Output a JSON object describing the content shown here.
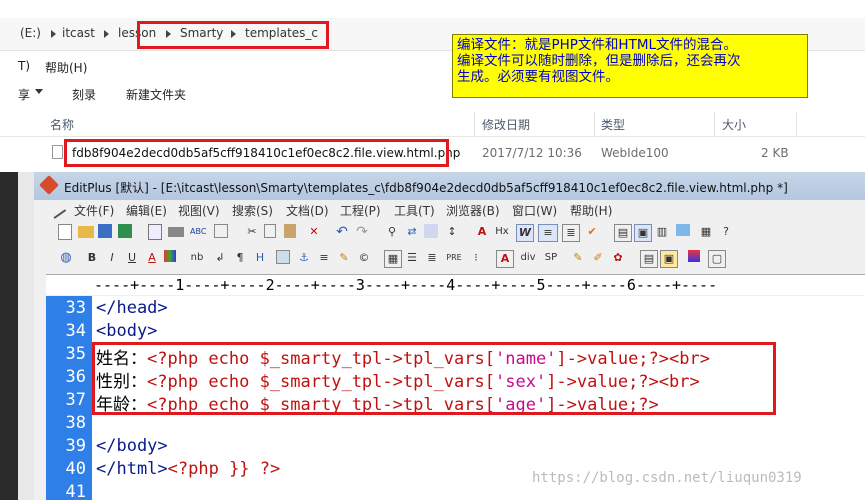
{
  "explorer": {
    "breadcrumb": [
      "(E:)",
      "itcast",
      "lesson",
      "Smarty",
      "templates_c"
    ],
    "menu": {
      "item0": "T)",
      "help": "帮助(H)"
    },
    "toolbar": {
      "share": "享",
      "burn": "刻录",
      "new_folder": "新建文件夹"
    },
    "columns": {
      "name": "名称",
      "modified": "修改日期",
      "type": "类型",
      "size": "大小"
    },
    "file": {
      "name": "fdb8f904e2decd0db5af5cff918410c1ef0ec8c2.file.view.html.php",
      "modified": "2017/7/12 10:36",
      "type": "WebIde100",
      "size": "2 KB"
    }
  },
  "annotation": {
    "lines": [
      "编译文件：就是PHP文件和HTML文件的混合。",
      "编译文件可以随时删除，但是删除后，还会再次",
      "生成。必须要有视图文件。"
    ]
  },
  "editplus": {
    "title": "EditPlus [默认] - [E:\\itcast\\lesson\\Smarty\\templates_c\\fdb8f904e2decd0db5af5cff918410c1ef0ec8c2.file.view.html.php *]",
    "menu": [
      "文件(F)",
      "编辑(E)",
      "视图(V)",
      "搜索(S)",
      "文档(D)",
      "工程(P)",
      "工具(T)",
      "浏览器(B)",
      "窗口(W)",
      "帮助(H)"
    ],
    "ruler": "----+----1----+----2----+----3----+----4----+----5----+----6----+----",
    "line_numbers": [
      "33",
      "34",
      "35",
      "36",
      "37",
      "38",
      "39",
      "40",
      "41"
    ],
    "code": {
      "l33": "</head>",
      "l34": "<body>",
      "l35_label": "姓名：",
      "l35_a": "<?php echo $_smarty_tpl->tpl_vars[",
      "l35_str": "'name'",
      "l35_b": "]->value;?><br>",
      "l36_label": "性别：",
      "l36_a": "<?php echo $_smarty_tpl->tpl_vars[",
      "l36_str": "'sex'",
      "l36_b": "]->value;?><br>",
      "l37_label": "年龄：",
      "l37_a": "<?php echo $_smarty_tpl->tpl_vars[",
      "l37_str": "'age'",
      "l37_b": "]->value;?>",
      "l39": "</body>",
      "l40_a": "</html>",
      "l40_b": "<?php }} ?>"
    },
    "toolbar_icons": [
      "new-file-icon",
      "open-folder-icon",
      "save-icon",
      "save-all-icon",
      "print-preview-icon",
      "print-icon",
      "spellcheck-icon",
      "cut-icon",
      "copy-icon",
      "paste-icon",
      "delete-icon",
      "undo-icon",
      "redo-icon",
      "find-icon",
      "replace-icon",
      "goto-icon",
      "font-icon",
      "hex-icon",
      "word-wrap-icon",
      "ruler-icon",
      "check-icon"
    ],
    "format_labels": {
      "bold": "B",
      "italic": "I",
      "underline": "U",
      "nb": "nb",
      "pre": "PRE",
      "div": "div",
      "sp": "SP"
    }
  },
  "watermark": "https://blog.csdn.net/liuqun0319"
}
